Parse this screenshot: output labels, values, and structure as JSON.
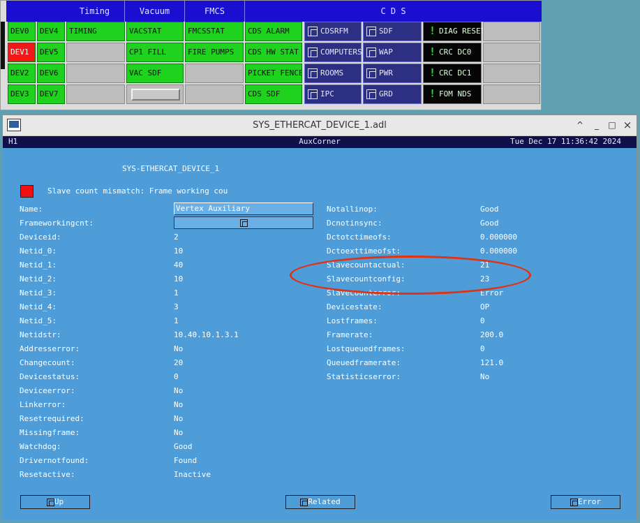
{
  "overview": {
    "headers": [
      "Timing",
      "Vacuum",
      "FMCS",
      "C D S"
    ],
    "dev": [
      {
        "label": "DEV0",
        "alarm": false
      },
      {
        "label": "DEV4",
        "alarm": false
      },
      {
        "label": "DEV1",
        "alarm": true
      },
      {
        "label": "DEV5",
        "alarm": false
      },
      {
        "label": "DEV2",
        "alarm": false
      },
      {
        "label": "DEV6",
        "alarm": false
      },
      {
        "label": "DEV3",
        "alarm": false
      },
      {
        "label": "DEV7",
        "alarm": false
      }
    ],
    "timing": [
      "TIMING"
    ],
    "vacuum": [
      "VACSTAT",
      "CP1 FILL",
      "VAC SDF"
    ],
    "fmcs": [
      "FMCSSTAT",
      "FIRE PUMPS"
    ],
    "cds_green": [
      "CDS ALARM",
      "CDS HW STAT",
      "PICKET FENCE",
      "CDS SDF"
    ],
    "cds_blue1": [
      "CDSRFM",
      "COMPUTERS",
      "ROOMS",
      "IPC"
    ],
    "cds_blue2": [
      "SDF",
      "WAP",
      "PWR",
      "GRD"
    ],
    "cds_black": [
      "DIAG RESET",
      "CRC DC0",
      "CRC DC1",
      "FOM NDS"
    ]
  },
  "window": {
    "title": "SYS_ETHERCAT_DEVICE_1.adl",
    "controls": {
      "up_arrow": "^",
      "minimize": "_",
      "maximize": "□",
      "close": "×"
    }
  },
  "statusbar": {
    "left": "H1",
    "center": "AuxCorner",
    "right": "Tue Dec 17 11:36:42 2024"
  },
  "screen": {
    "heading": "SYS-ETHERCAT_DEVICE_1",
    "alarm_text": "Slave count mismatch: Frame working cou",
    "alarm_color": "#f01010",
    "name_label": "Name:",
    "name_value": "Vertex Auxiliary",
    "fwc_label": "Frameworkingcnt:",
    "left_fields": [
      {
        "label": "Deviceid:",
        "value": "2"
      },
      {
        "label": "Netid_0:",
        "value": "10"
      },
      {
        "label": "Netid_1:",
        "value": "40"
      },
      {
        "label": "Netid_2:",
        "value": "10"
      },
      {
        "label": "Netid_3:",
        "value": "1"
      },
      {
        "label": "Netid_4:",
        "value": "3"
      },
      {
        "label": "Netid_5:",
        "value": "1"
      },
      {
        "label": "Netidstr:",
        "value": "10.40.10.1.3.1"
      },
      {
        "label": "Addresserror:",
        "value": "No"
      },
      {
        "label": "Changecount:",
        "value": "20"
      },
      {
        "label": "Devicestatus:",
        "value": "0"
      },
      {
        "label": "Deviceerror:",
        "value": "No"
      },
      {
        "label": "Linkerror:",
        "value": "No"
      },
      {
        "label": "Resetrequired:",
        "value": "No"
      },
      {
        "label": "Missingframe:",
        "value": "No"
      },
      {
        "label": "Watchdog:",
        "value": "Good"
      },
      {
        "label": "Drivernotfound:",
        "value": "Found"
      },
      {
        "label": "Resetactive:",
        "value": "Inactive"
      }
    ],
    "right_fields": [
      {
        "label": "Notallinop:",
        "value": "Good"
      },
      {
        "label": "Dcnotinsync:",
        "value": "Good"
      },
      {
        "label": "Dctotctimeofs:",
        "value": "0.000000"
      },
      {
        "label": "Dctoexttimeofst:",
        "value": "0.000000"
      },
      {
        "label": "Slavecountactual:",
        "value": "21"
      },
      {
        "label": "Slavecountconfig:",
        "value": "23"
      },
      {
        "label": "Slavecounterror:",
        "value": "Error"
      },
      {
        "label": "Devicestate:",
        "value": "OP"
      },
      {
        "label": "Lostframes:",
        "value": "0"
      },
      {
        "label": "Framerate:",
        "value": "200.0"
      },
      {
        "label": "Lostqueuedframes:",
        "value": "0"
      },
      {
        "label": "Queuedframerate:",
        "value": "121.0"
      },
      {
        "label": "Statisticserror:",
        "value": "No"
      }
    ],
    "buttons": {
      "up": "Up",
      "related": "Related",
      "error": "Error"
    }
  }
}
